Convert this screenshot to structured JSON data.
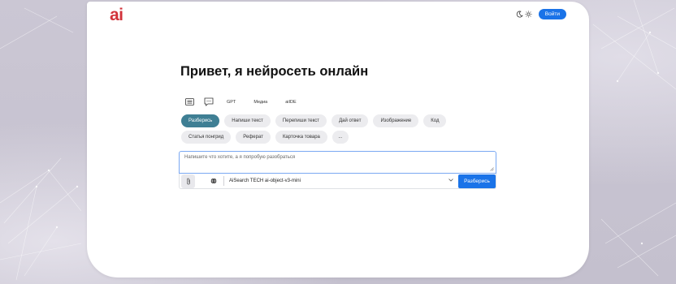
{
  "header": {
    "logo": "ai",
    "login_label": "Войти",
    "theme_icons": [
      "moon-icon",
      "sun-icon"
    ]
  },
  "main": {
    "heading": "Привет, я нейросеть онлайн",
    "modes": {
      "icons": [
        "list-icon",
        "chat-icon"
      ],
      "tabs": [
        "GPT",
        "Медиа",
        "aiIDE"
      ]
    },
    "chips_row1": [
      "Разберись",
      "Напиши текст",
      "Перепиши текст",
      "Дай ответ",
      "Изображение",
      "Код"
    ],
    "chips_row2": [
      "Статья понгрид",
      "Реферат",
      "Карточка товара",
      "..."
    ],
    "active_chip": "Разберись"
  },
  "composer": {
    "placeholder": "Напишите что хотите, а я попробую разобраться",
    "value": "",
    "model": "AiSearch TECH ai-object-v3-mini",
    "submit_label": "Разберись"
  },
  "colors": {
    "accent": "#1a73e8",
    "active_chip": "#3f7f94",
    "logo": "#d2323a",
    "background": "#c9c5d2"
  }
}
